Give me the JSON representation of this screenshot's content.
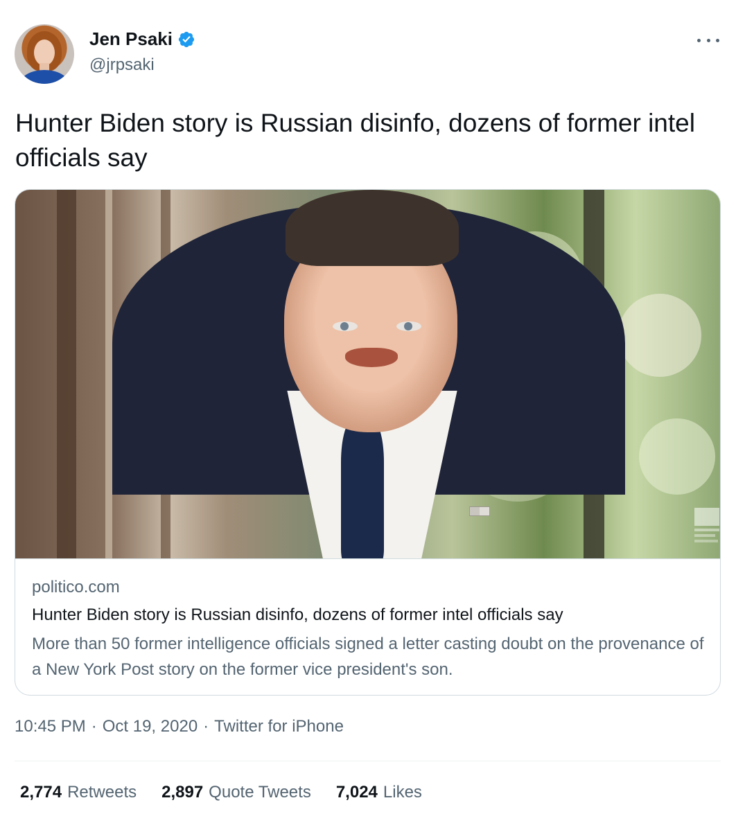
{
  "tweet": {
    "author": {
      "display_name": "Jen Psaki",
      "handle": "@jrpsaki",
      "verified": true,
      "avatar_icon": "profile-photo"
    },
    "text": "Hunter Biden story is Russian disinfo, dozens of former intel officials say",
    "card": {
      "domain": "politico.com",
      "title": "Hunter Biden story is Russian disinfo, dozens of former intel officials say",
      "description": "More than 50 former intelligence officials signed a letter casting doubt on the provenance of a New York Post story on the former vice president's son."
    },
    "meta": {
      "time": "10:45 PM",
      "date": "Oct 19, 2020",
      "source": "Twitter for iPhone"
    },
    "stats": {
      "retweets_count": "2,774",
      "retweets_label": "Retweets",
      "quotes_count": "2,897",
      "quotes_label": "Quote Tweets",
      "likes_count": "7,024",
      "likes_label": "Likes"
    },
    "colors": {
      "verified_blue": "#1d9bf0",
      "text_primary": "#0f1419",
      "text_secondary": "#536471",
      "border": "#cfd9de"
    }
  }
}
